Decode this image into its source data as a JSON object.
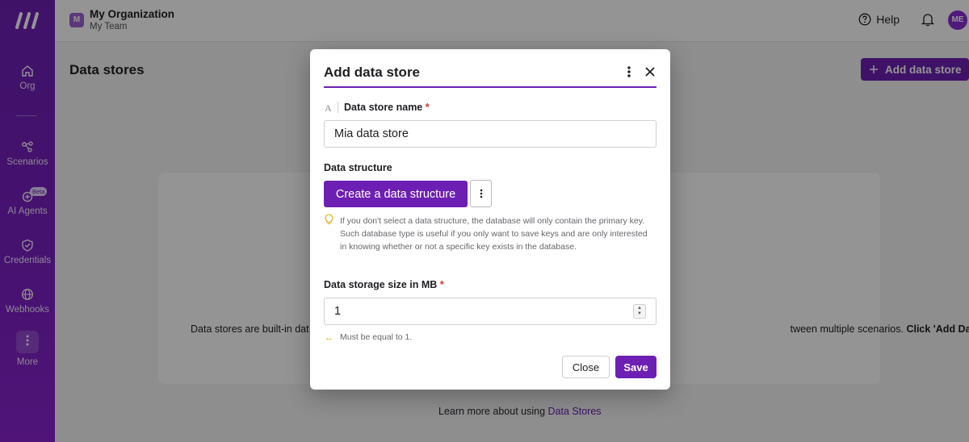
{
  "sidebar": {
    "items": [
      {
        "label": "Org",
        "icon": "home-icon"
      },
      {
        "label": "Scenarios",
        "icon": "share-nodes-icon"
      },
      {
        "label": "AI Agents",
        "icon": "ai-agent-icon",
        "badge": "Beta"
      },
      {
        "label": "Credentials",
        "icon": "shield-check-icon"
      },
      {
        "label": "Webhooks",
        "icon": "globe-icon"
      },
      {
        "label": "More",
        "icon": "vertical-dots-icon"
      }
    ]
  },
  "header": {
    "org_initial": "M",
    "org_name": "My Organization",
    "team_name": "My Team",
    "help_label": "Help",
    "avatar_initials": "ME"
  },
  "main": {
    "page_title": "Data stores",
    "add_button_label": "Add data store",
    "empty_text_start": "Data stores are built-in dat",
    "empty_text_end": "tween multiple scenarios.",
    "empty_text_bold": "Click 'Add Data",
    "learn_more_prefix": "Learn more about using",
    "learn_more_link": "Data Stores"
  },
  "modal": {
    "title": "Add data store",
    "name_field_type_icon": "A",
    "name_label": "Data store name",
    "required_mark": "*",
    "name_value": "Mia data store",
    "structure_label": "Data structure",
    "create_structure_label": "Create a data structure",
    "structure_hint": "If you don't select a data structure, the database will only contain the primary key. Such database type is useful if you only want to save keys and are only interested in knowing whether or not a specific key exists in the database.",
    "size_label": "Data storage size in MB",
    "size_value": "1",
    "size_rule": "Must be equal to 1.",
    "close_label": "Close",
    "save_label": "Save"
  },
  "colors": {
    "brand": "#6d1fb3",
    "sidebar": "#7a1fc2",
    "required": "#d93025",
    "hint_icon": "#e0a800"
  }
}
